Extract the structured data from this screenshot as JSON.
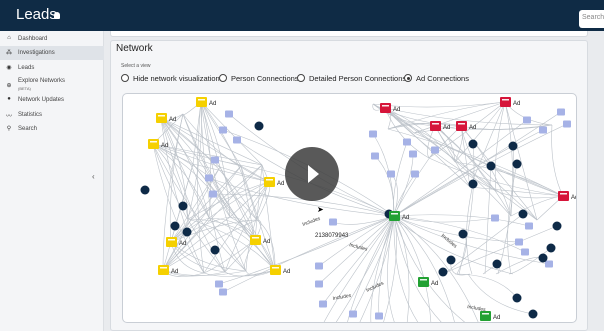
{
  "header": {
    "title": "Leads",
    "search_placeholder": "Search"
  },
  "sidebar": {
    "items": [
      {
        "icon": "home-icon",
        "label": "Dashboard",
        "active": false
      },
      {
        "icon": "network-icon",
        "label": "Investigations",
        "active": true
      },
      {
        "icon": "leads-icon",
        "label": "Leads",
        "active": false
      },
      {
        "icon": "globe-icon",
        "label": "Explore Networks",
        "sub": "(BETA)",
        "active": false
      },
      {
        "icon": "updates-icon",
        "label": "Network Updates",
        "active": false
      },
      {
        "icon": "statistics-icon",
        "label": "Statistics",
        "active": false
      },
      {
        "icon": "search-icon",
        "label": "Search",
        "active": false
      }
    ],
    "collapse_glyph": "‹"
  },
  "main": {
    "title": "Network",
    "view_label": "Select a view",
    "options": [
      {
        "label": "Hide network visualization",
        "selected": false
      },
      {
        "label": "Person Connections",
        "selected": false
      },
      {
        "label": "Detailed Person Connections",
        "selected": false
      },
      {
        "label": "Ad Connections",
        "selected": true
      }
    ]
  },
  "network": {
    "phone_number": "2138079943",
    "ad_label": "Ad",
    "edge_label": "Includes",
    "colors": {
      "yellow": "#f5d000",
      "red": "#d6153a",
      "green": "#22a133",
      "navy": "#0e2a47",
      "blue": "#a6b2e6",
      "edge": "#bcc2c9"
    }
  },
  "video": {
    "play_icon": "play-icon"
  }
}
